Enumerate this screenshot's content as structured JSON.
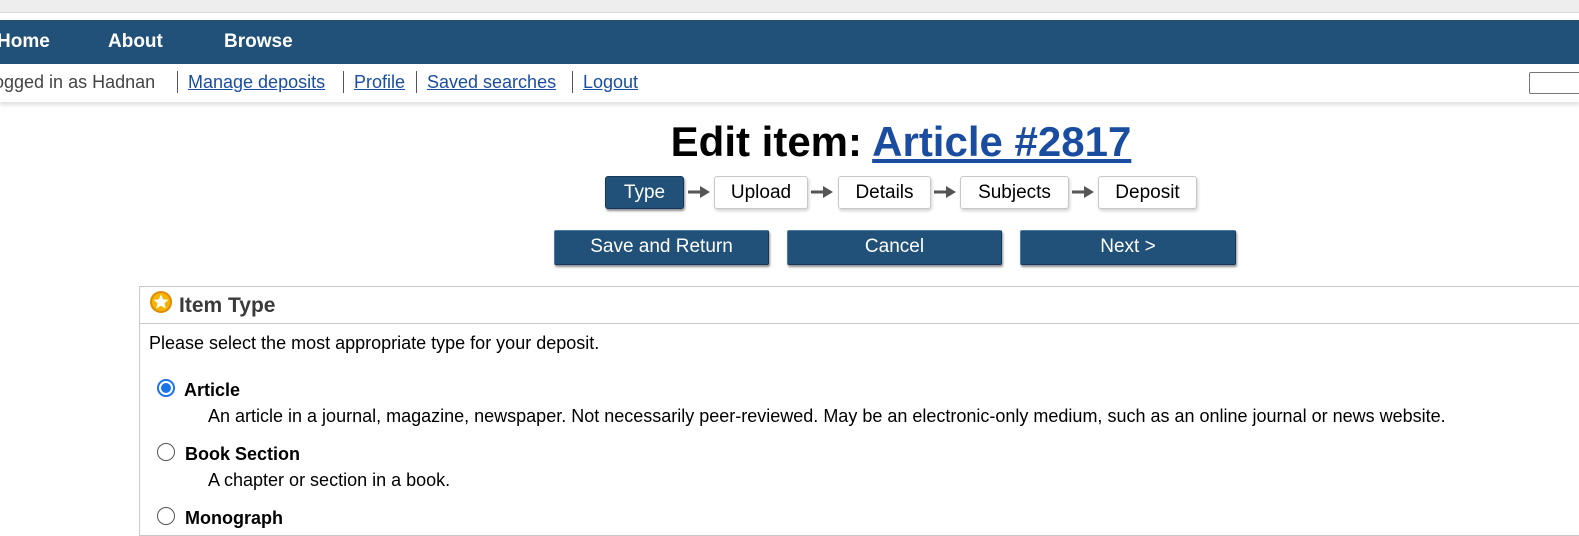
{
  "nav": {
    "items": [
      "Home",
      "About",
      "Browse"
    ]
  },
  "user_bar": {
    "status": "ogged in as Hadnan",
    "links": [
      "Manage deposits",
      "Profile",
      "Saved searches",
      "Logout"
    ]
  },
  "page": {
    "title_prefix": "Edit item:",
    "title_link": "Article #2817"
  },
  "workflow": {
    "steps": [
      "Type",
      "Upload",
      "Details",
      "Subjects",
      "Deposit"
    ],
    "active_step": "Type"
  },
  "buttons": {
    "save_return": "Save and Return",
    "cancel": "Cancel",
    "next": "Next >"
  },
  "item_type": {
    "title": "Item Type",
    "instruction": "Please select the most appropriate type for your deposit.",
    "options": [
      {
        "label": "Article",
        "description": "An article in a journal, magazine, newspaper. Not necessarily peer-reviewed. May be an electronic-only medium, such as an online journal or news website.",
        "selected": true
      },
      {
        "label": "Book Section",
        "description": "A chapter or section in a book.",
        "selected": false
      },
      {
        "label": "Monograph",
        "description": "",
        "selected": false
      }
    ]
  },
  "colors": {
    "nav_bg": "#215178",
    "link": "#1a4da0",
    "radio_checked": "#1a73e8"
  },
  "icons": {
    "item_type": "star-icon",
    "step_arrow": "arrow-right-icon"
  }
}
